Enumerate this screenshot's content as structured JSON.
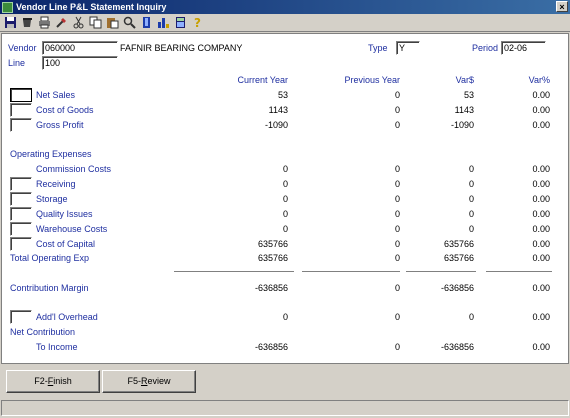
{
  "window": {
    "title": "Vendor Line P&L Statement Inquiry",
    "close_label": "×"
  },
  "toolbar": {
    "icons": [
      "save-icon",
      "cup-icon",
      "print-icon",
      "tool-icon",
      "cut-icon",
      "copy-icon",
      "paste-icon",
      "search-icon",
      "bookmark-icon",
      "chart-icon",
      "calculator-icon",
      "help-icon"
    ]
  },
  "header": {
    "vendor_label": "Vendor",
    "vendor_value": "060000",
    "vendor_name": "FAFNIR BEARING COMPANY",
    "line_label": "Line",
    "line_value": "100",
    "type_label": "Type",
    "type_value": "Y",
    "period_label": "Period",
    "period_value": "02-06"
  },
  "columns": {
    "current": "Current Year",
    "previous": "Previous Year",
    "var_amt": "Var$",
    "var_pct": "Var%"
  },
  "rows": {
    "net_sales": {
      "label": "Net Sales",
      "current": "53",
      "previous": "0",
      "var_amt": "53",
      "var_pct": "0.00"
    },
    "cost_of_goods": {
      "label": "Cost of Goods",
      "current": "1143",
      "previous": "0",
      "var_amt": "1143",
      "var_pct": "0.00"
    },
    "gross_profit": {
      "label": "Gross Profit",
      "current": "-1090",
      "previous": "0",
      "var_amt": "-1090",
      "var_pct": "0.00"
    },
    "operating_expenses": {
      "label": "Operating Expenses"
    },
    "commission_costs": {
      "label": "Commission Costs",
      "current": "0",
      "previous": "0",
      "var_amt": "0",
      "var_pct": "0.00"
    },
    "receiving": {
      "label": "Receiving",
      "current": "0",
      "previous": "0",
      "var_amt": "0",
      "var_pct": "0.00"
    },
    "storage": {
      "label": "Storage",
      "current": "0",
      "previous": "0",
      "var_amt": "0",
      "var_pct": "0.00"
    },
    "quality_issues": {
      "label": "Quality Issues",
      "current": "0",
      "previous": "0",
      "var_amt": "0",
      "var_pct": "0.00"
    },
    "warehouse_costs": {
      "label": "Warehouse Costs",
      "current": "0",
      "previous": "0",
      "var_amt": "0",
      "var_pct": "0.00"
    },
    "cost_of_capital": {
      "label": "Cost of Capital",
      "current": "635766",
      "previous": "0",
      "var_amt": "635766",
      "var_pct": "0.00"
    },
    "total_operating_exp": {
      "label": "Total Operating Exp",
      "current": "635766",
      "previous": "0",
      "var_amt": "635766",
      "var_pct": "0.00"
    },
    "contribution_margin": {
      "label": "Contribution Margin",
      "current": "-636856",
      "previous": "0",
      "var_amt": "-636856",
      "var_pct": "0.00"
    },
    "addl_overhead": {
      "label": "Add'l Overhead",
      "current": "0",
      "previous": "0",
      "var_amt": "0",
      "var_pct": "0.00"
    },
    "net_contribution": {
      "label": "Net Contribution"
    },
    "to_income": {
      "label": "To Income",
      "current": "-636856",
      "previous": "0",
      "var_amt": "-636856",
      "var_pct": "0.00"
    }
  },
  "buttons": {
    "finish": {
      "prefix": "F2-",
      "key": "F",
      "rest": "inish"
    },
    "review": {
      "prefix": "F5-",
      "key": "R",
      "rest": "eview"
    }
  },
  "colors": {
    "label": "#1f2fa0",
    "titlebar": "#0a246a",
    "face": "#d4d0c8"
  }
}
